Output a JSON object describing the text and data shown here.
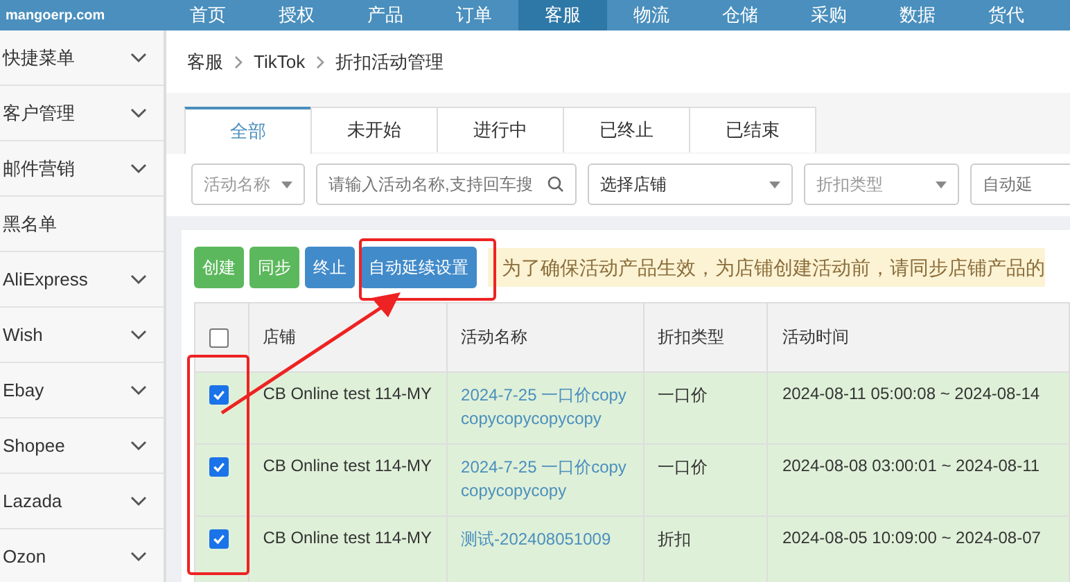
{
  "header": {
    "logo": "mangoerp.com",
    "nav": [
      {
        "label": "首页",
        "selected": false
      },
      {
        "label": "授权",
        "selected": false
      },
      {
        "label": "产品",
        "selected": false
      },
      {
        "label": "订单",
        "selected": false
      },
      {
        "label": "客服",
        "selected": true
      },
      {
        "label": "物流",
        "selected": false
      },
      {
        "label": "仓储",
        "selected": false
      },
      {
        "label": "采购",
        "selected": false
      },
      {
        "label": "数据",
        "selected": false
      },
      {
        "label": "货代",
        "selected": false
      }
    ]
  },
  "sidebar": {
    "items": [
      {
        "label": "快捷菜单",
        "expandable": true
      },
      {
        "label": "客户管理",
        "expandable": true
      },
      {
        "label": "邮件营销",
        "expandable": true
      },
      {
        "label": "黑名单",
        "expandable": false
      },
      {
        "label": "AliExpress",
        "expandable": true
      },
      {
        "label": "Wish",
        "expandable": true
      },
      {
        "label": "Ebay",
        "expandable": true
      },
      {
        "label": "Shopee",
        "expandable": true
      },
      {
        "label": "Lazada",
        "expandable": true
      },
      {
        "label": "Ozon",
        "expandable": true
      }
    ]
  },
  "breadcrumb": [
    "客服",
    "TikTok",
    "折扣活动管理"
  ],
  "tabs": [
    {
      "label": "全部",
      "selected": true
    },
    {
      "label": "未开始",
      "selected": false
    },
    {
      "label": "进行中",
      "selected": false
    },
    {
      "label": "已终止",
      "selected": false
    },
    {
      "label": "已结束",
      "selected": false
    }
  ],
  "filters": [
    {
      "kind": "select",
      "value": "活动名称",
      "placeholder_style": true
    },
    {
      "kind": "search",
      "placeholder": "请输入活动名称,支持回车搜"
    },
    {
      "kind": "select",
      "value": "选择店铺",
      "placeholder_style": false
    },
    {
      "kind": "select",
      "value": "折扣类型",
      "placeholder_style": true
    },
    {
      "kind": "text",
      "placeholder": "自动延"
    }
  ],
  "actions": [
    {
      "label": "创建",
      "color": "#5cb85c"
    },
    {
      "label": "同步",
      "color": "#5cb85c"
    },
    {
      "label": "终止",
      "color": "#428bca"
    },
    {
      "label": "自动延续设置",
      "color": "#428bca"
    }
  ],
  "notice": "为了确保活动产品生效，为店铺创建活动前，请同步店铺产品的",
  "table": {
    "header_checked": false,
    "columns": [
      "店铺",
      "活动名称",
      "折扣类型",
      "活动时间"
    ],
    "rows": [
      {
        "checked": true,
        "shop": "CB Online test 114-MY",
        "name": "2024-7-25 一口价copy copycopycopycopy",
        "type": "一口价",
        "time": "2024-08-11 05:00:08 ~ 2024-08-14"
      },
      {
        "checked": true,
        "shop": "CB Online test 114-MY",
        "name": "2024-7-25 一口价copy copycopycopy",
        "type": "一口价",
        "time": "2024-08-08 03:00:01 ~ 2024-08-11"
      },
      {
        "checked": true,
        "shop": "CB Online test 114-MY",
        "name": "测试-202408051009",
        "type": "折扣",
        "time": "2024-08-05 10:09:00 ~ 2024-08-07"
      }
    ]
  }
}
